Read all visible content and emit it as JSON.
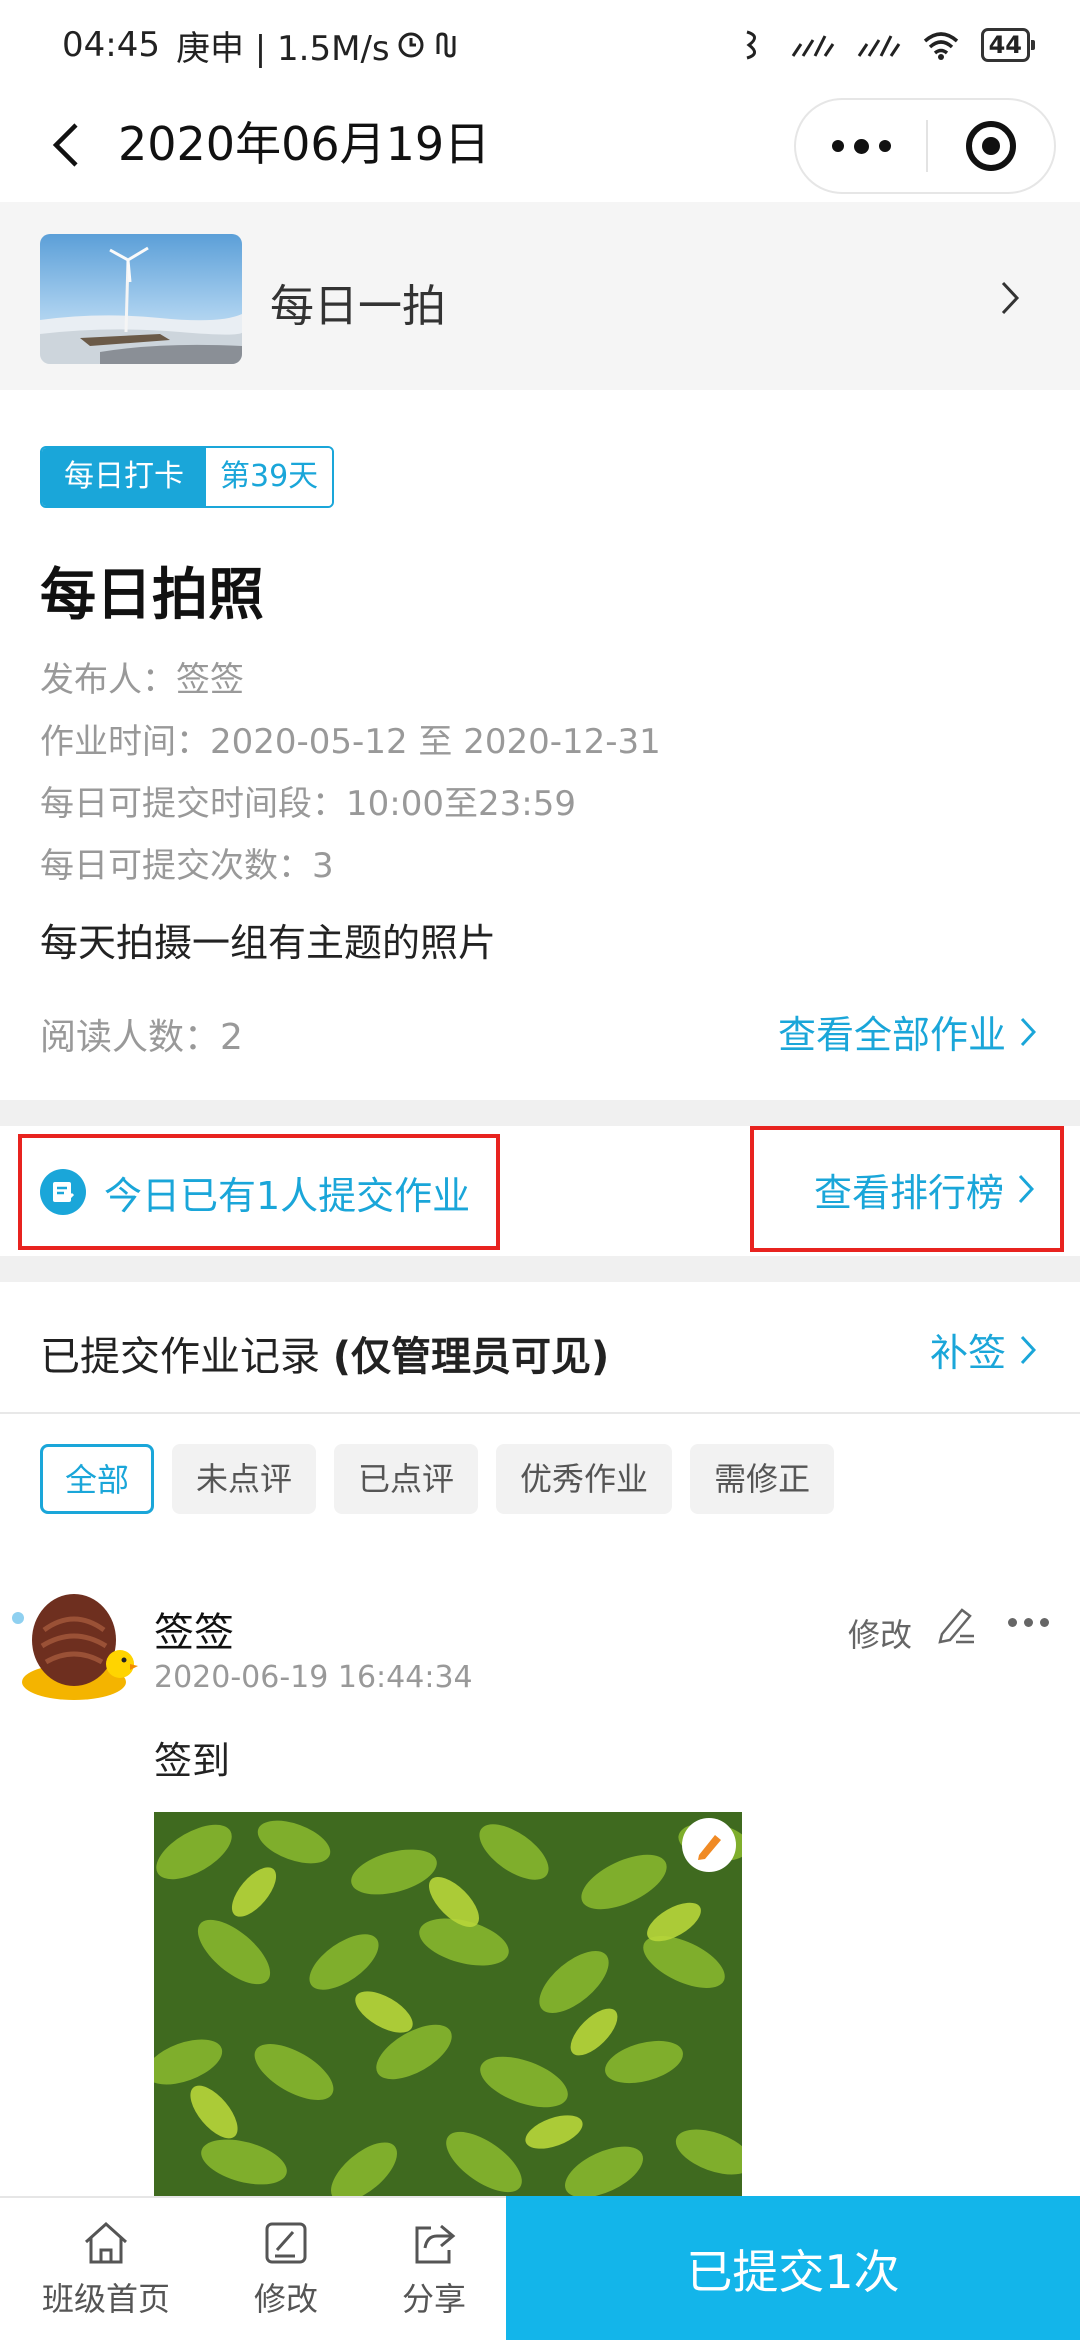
{
  "status_bar": {
    "time": "04:45",
    "extra": "庚申 | 1.5M/s",
    "battery": "44"
  },
  "nav": {
    "title": "2020年06月19日"
  },
  "class_card": {
    "name": "每日一拍"
  },
  "homework": {
    "tag_type": "每日打卡",
    "tag_day": "第39天",
    "title": "每日拍照",
    "publisher": "发布人：签签",
    "period": "作业时间：2020-05-12 至 2020-12-31",
    "submit_window": "每日可提交时间段：10:00至23:59",
    "submit_times": "每日可提交次数：3",
    "description": "每天拍摄一组有主题的照片",
    "readers": "阅读人数：2",
    "view_all": "查看全部作业"
  },
  "today": {
    "text": "今日已有1人提交作业",
    "ranking": "查看排行榜"
  },
  "records": {
    "title": "已提交作业记录 ",
    "title_bold": "(仅管理员可见)",
    "makeup": "补签"
  },
  "filters": [
    "全部",
    "未点评",
    "已点评",
    "优秀作业",
    "需修正"
  ],
  "post": {
    "name": "签签",
    "time": "2020-06-19 16:44:34",
    "edit": "修改",
    "text": "签到"
  },
  "bottom_bar": {
    "home": "班级首页",
    "edit": "修改",
    "share": "分享",
    "submit": "已提交1次"
  },
  "colors": {
    "accent": "#1aa6d9",
    "submit_bg": "#13b5ea",
    "highlight_box": "#e8231f"
  }
}
